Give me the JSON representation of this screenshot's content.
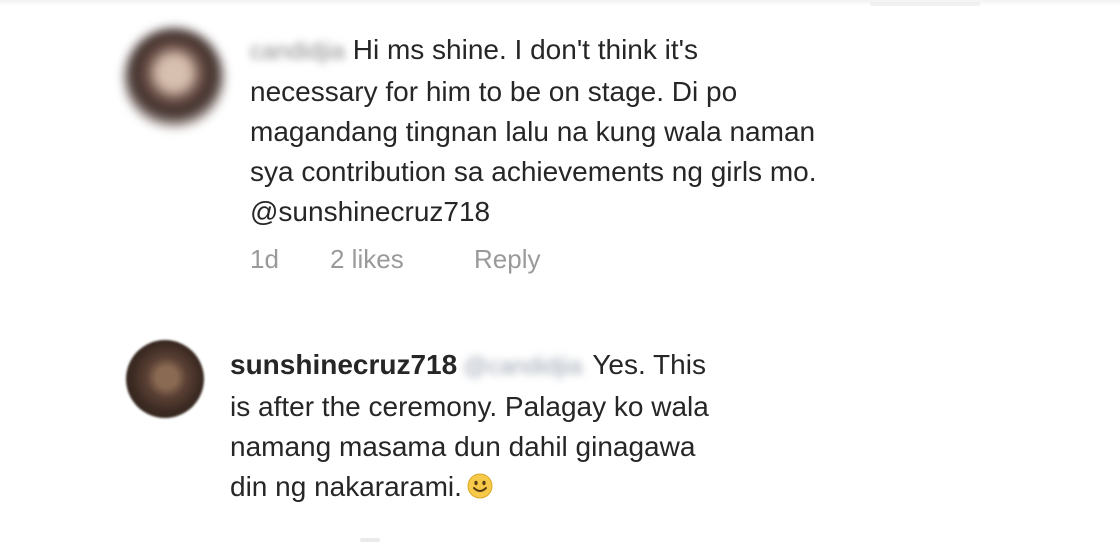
{
  "comments": [
    {
      "username": "candidjia",
      "text_lines": [
        "Hi ms shine. I don't think it's",
        "necessary for him to be on stage. Di po",
        "magandang tingnan lalu na kung wala naman",
        "sya contribution sa achievements ng girls mo.",
        "@sunshinecruz718"
      ],
      "time": "1d",
      "likes": "2 likes",
      "reply_label": "Reply"
    },
    {
      "username": "sunshinecruz718",
      "mention": "@candidjia",
      "text_first": "Yes. This",
      "text_lines": [
        "is after the ceremony. Palagay ko wala",
        "namang masama dun dahil ginagawa",
        "din ng nakararami."
      ],
      "emoji": "smiley-icon"
    }
  ],
  "colors": {
    "text": "#262626",
    "meta": "#9a9a9a",
    "emoji": "#f7c948"
  }
}
